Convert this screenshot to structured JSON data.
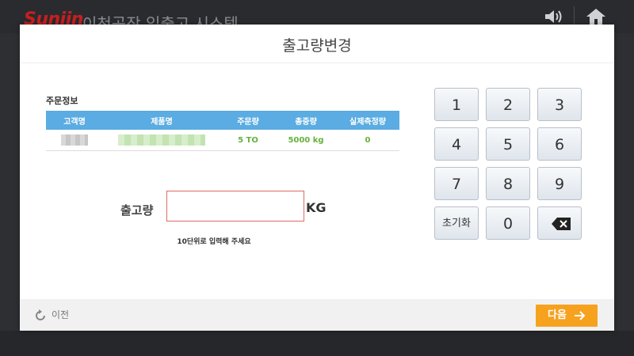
{
  "app": {
    "logo": "Sunjin",
    "title": "이천공장 입출고 시스템"
  },
  "modal": {
    "title": "출고량변경",
    "section_label": "주문정보",
    "table": {
      "headers": [
        "고객명",
        "제품명",
        "주문량",
        "총중량",
        "실제측정량"
      ],
      "rows": [
        {
          "customer": "",
          "product": "",
          "order_qty": "5 TO",
          "total_weight": "5000 kg",
          "measured": "0"
        }
      ]
    },
    "quantity": {
      "label": "출고량",
      "value": "",
      "placeholder": "",
      "unit": "KG",
      "hint": "10단위로 입력해 주세요"
    },
    "keypad": {
      "keys": [
        "1",
        "2",
        "3",
        "4",
        "5",
        "6",
        "7",
        "8",
        "9",
        "초기화",
        "0"
      ],
      "backspace_icon": "backspace-icon"
    },
    "footer": {
      "prev_label": "이전",
      "next_label": "다음"
    }
  },
  "colors": {
    "accent_orange": "#f6a21f",
    "table_header": "#5aace2",
    "value_green": "#65b23a",
    "input_border": "#e06a62"
  }
}
